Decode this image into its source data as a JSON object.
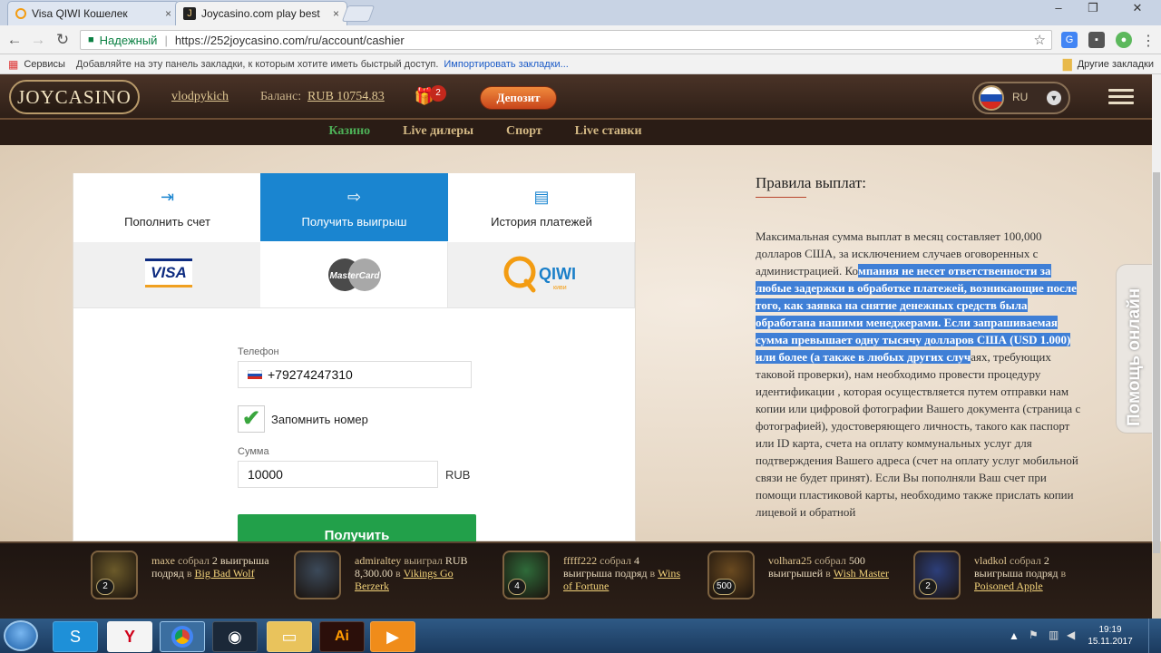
{
  "browser": {
    "tabs": [
      {
        "title": "Visa QIWI Кошелек",
        "close": "×"
      },
      {
        "title": "Joycasino.com play best",
        "close": "×"
      }
    ],
    "window_controls": [
      "–",
      "❐",
      "✕"
    ],
    "secure_label": "Надежный",
    "url": "https://252joycasino.com/ru/account/cashier",
    "bookmarks": {
      "apps": "Сервисы",
      "hint": "Добавляйте на эту панель закладки, к которым хотите иметь быстрый доступ.",
      "import": "Импортировать закладки...",
      "other": "Другие закладки"
    }
  },
  "site": {
    "logo": "JOYCASINO",
    "username": "vlodpykich",
    "balance_label": "Баланс:",
    "balance": "RUB 10754.83",
    "gift_count": "2",
    "deposit": "Депозит",
    "language": "RU",
    "nav": [
      {
        "label": "Казино",
        "active": true
      },
      {
        "label": "Live дилеры",
        "active": false
      },
      {
        "label": "Спорт",
        "active": false
      },
      {
        "label": "Live ставки",
        "active": false
      }
    ]
  },
  "cashier": {
    "tabs": [
      {
        "label": "Пополнить счет",
        "icon": "login-icon"
      },
      {
        "label": "Получить выигрыш",
        "icon": "logout-icon",
        "active": true
      },
      {
        "label": "История платежей",
        "icon": "document-icon"
      }
    ],
    "methods": {
      "visa": "VISA",
      "mastercard": "MasterCard",
      "qiwi": "QIWI",
      "qiwi_sub": "киви"
    },
    "phone_label": "Телефон",
    "phone": "+79274247310",
    "remember_label": "Запомнить номер",
    "remember_check": "✔",
    "amount_label": "Сумма",
    "amount": "10000",
    "currency": "RUB",
    "submit": "Получить"
  },
  "rules": {
    "title": "Правила выплат:",
    "text_before": "Максимальная сумма выплат в месяц составляет 100,000 долларов США, за исключением случаев оговоренных с администрацией. Ко",
    "text_highlight": "мпания не несет ответственности за любые задержки в обработке платежей, возникающие после того, как заявка на снятие денежных средств была обработана нашими менеджерами. Если запрашиваемая сумма превышает одну тысячу долларов США (USD 1.000) или более (а также в любых других случ",
    "text_after": "аях, требующих таковой проверки), нам необходимо провести процедуру идентификации , которая осуществляется путем отправки нам копии или цифровой фотографии Вашего документа (страница с фотографией), удостоверяющего личность, такого как паспорт или ID карта, счета на оплату коммунальных услуг для подтверждения Вашего адреса (счет на оплату услуг мобильной связи не будет принят). Если Вы пополняли Ваш счет при помощи пластиковой карты, необходимо также прислать копии лицевой и обратной"
  },
  "help_label": "Помощь онлайн",
  "winners": [
    {
      "name": "maxe",
      "verb": "собрал",
      "amount": "2 выигрыша подряд",
      "prep": "в",
      "game": "Big Bad Wolf",
      "badge": "2",
      "color": "#6b5a2a"
    },
    {
      "name": "admiraltey",
      "verb": "выиграл",
      "amount": "RUB 8,300.00",
      "prep": "в",
      "game": "Vikings Go Berzerk",
      "badge": "",
      "color": "#3c4a5a"
    },
    {
      "name": "fffff222",
      "verb": "собрал",
      "amount": "4 выигрыша подряд",
      "prep": "в",
      "game": "Wins of Fortune",
      "badge": "4",
      "color": "#2f6b3a"
    },
    {
      "name": "volhara25",
      "verb": "собрал",
      "amount": "500 выигрышей",
      "prep": "в",
      "game": "Wish Master",
      "badge": "500",
      "color": "#6a4a20"
    },
    {
      "name": "vladkol",
      "verb": "собрал",
      "amount": "2 выигрыша подряд",
      "prep": "в",
      "game": "Poisoned Apple",
      "badge": "2",
      "color": "#2d3f7a"
    }
  ],
  "taskbar": {
    "time": "19:19",
    "date": "15.11.2017"
  },
  "colors": {
    "accent_blue": "#1a85d0",
    "submit_green": "#22a04a",
    "nav_active": "#4db057",
    "deposit_orange": "#e0702c"
  }
}
